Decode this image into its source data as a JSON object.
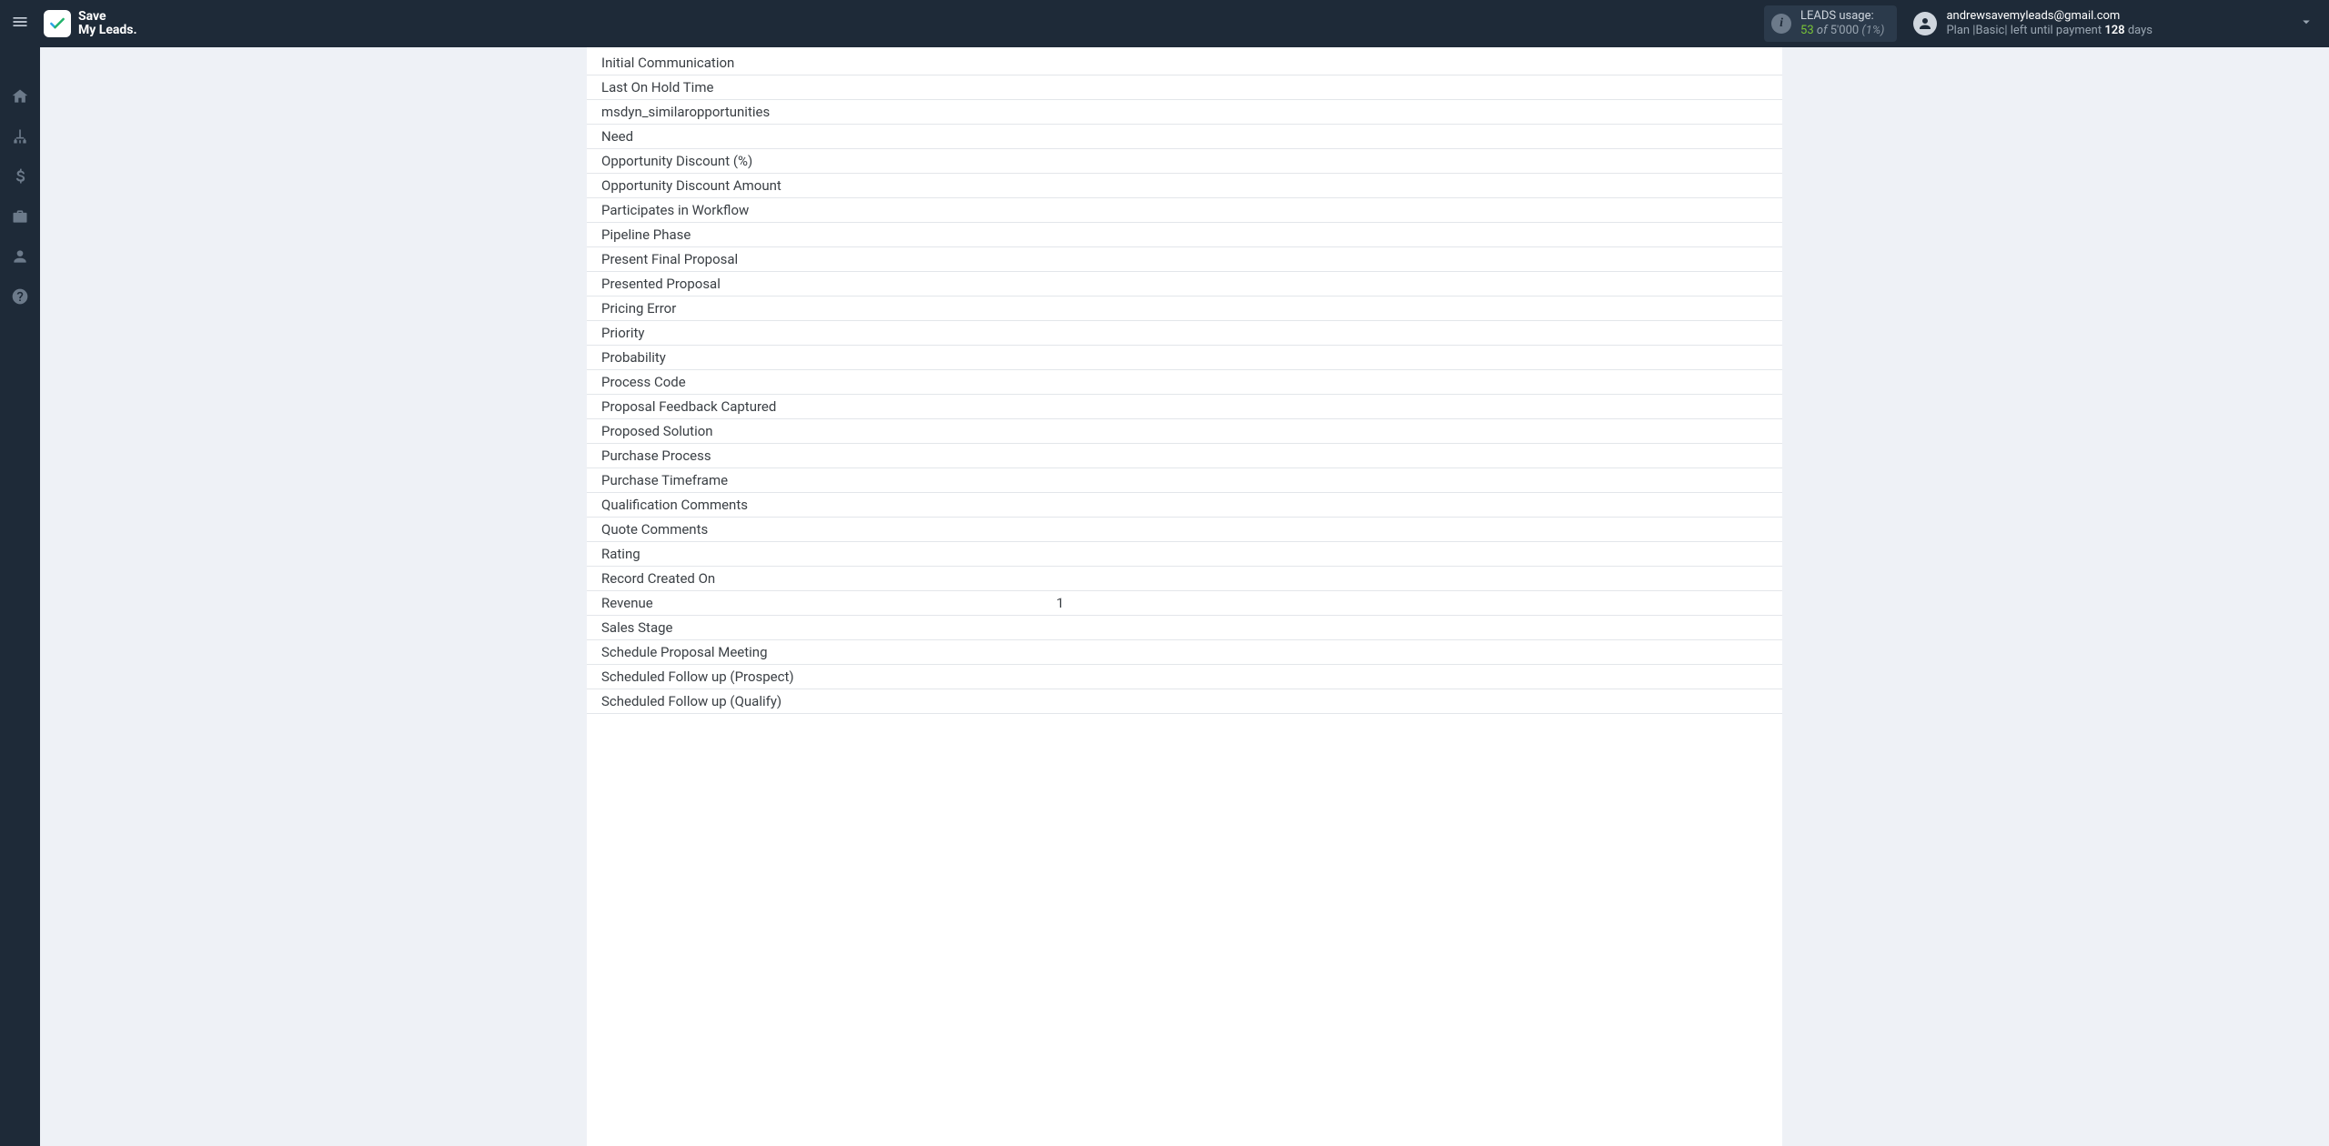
{
  "brand": {
    "line1": "Save",
    "line2": "My Leads."
  },
  "header": {
    "usage": {
      "label": "LEADS usage:",
      "used": "53",
      "of": "of",
      "total": "5'000",
      "percent": "(1%)"
    },
    "account": {
      "email": "andrewsavemyleads@gmail.com",
      "plan_pre": "Plan |",
      "plan_name": "Basic",
      "plan_mid": "| left until payment ",
      "days": "128",
      "days_suffix": " days"
    }
  },
  "sidebar": {
    "items": [
      {
        "name": "home"
      },
      {
        "name": "connections"
      },
      {
        "name": "billing"
      },
      {
        "name": "workspace"
      },
      {
        "name": "account"
      },
      {
        "name": "help"
      }
    ]
  },
  "fields": [
    {
      "label": "Initial Communication",
      "value": ""
    },
    {
      "label": "Last On Hold Time",
      "value": ""
    },
    {
      "label": "msdyn_similaropportunities",
      "value": ""
    },
    {
      "label": "Need",
      "value": ""
    },
    {
      "label": "Opportunity Discount (%)",
      "value": ""
    },
    {
      "label": "Opportunity Discount Amount",
      "value": ""
    },
    {
      "label": "Participates in Workflow",
      "value": ""
    },
    {
      "label": "Pipeline Phase",
      "value": ""
    },
    {
      "label": "Present Final Proposal",
      "value": ""
    },
    {
      "label": "Presented Proposal",
      "value": ""
    },
    {
      "label": "Pricing Error",
      "value": ""
    },
    {
      "label": "Priority",
      "value": ""
    },
    {
      "label": "Probability",
      "value": ""
    },
    {
      "label": "Process Code",
      "value": ""
    },
    {
      "label": "Proposal Feedback Captured",
      "value": ""
    },
    {
      "label": "Proposed Solution",
      "value": ""
    },
    {
      "label": "Purchase Process",
      "value": ""
    },
    {
      "label": "Purchase Timeframe",
      "value": ""
    },
    {
      "label": "Qualification Comments",
      "value": ""
    },
    {
      "label": "Quote Comments",
      "value": ""
    },
    {
      "label": "Rating",
      "value": ""
    },
    {
      "label": "Record Created On",
      "value": ""
    },
    {
      "label": "Revenue",
      "value": "1"
    },
    {
      "label": "Sales Stage",
      "value": ""
    },
    {
      "label": "Schedule Proposal Meeting",
      "value": ""
    },
    {
      "label": "Scheduled Follow up (Prospect)",
      "value": ""
    },
    {
      "label": "Scheduled Follow up (Qualify)",
      "value": ""
    }
  ]
}
